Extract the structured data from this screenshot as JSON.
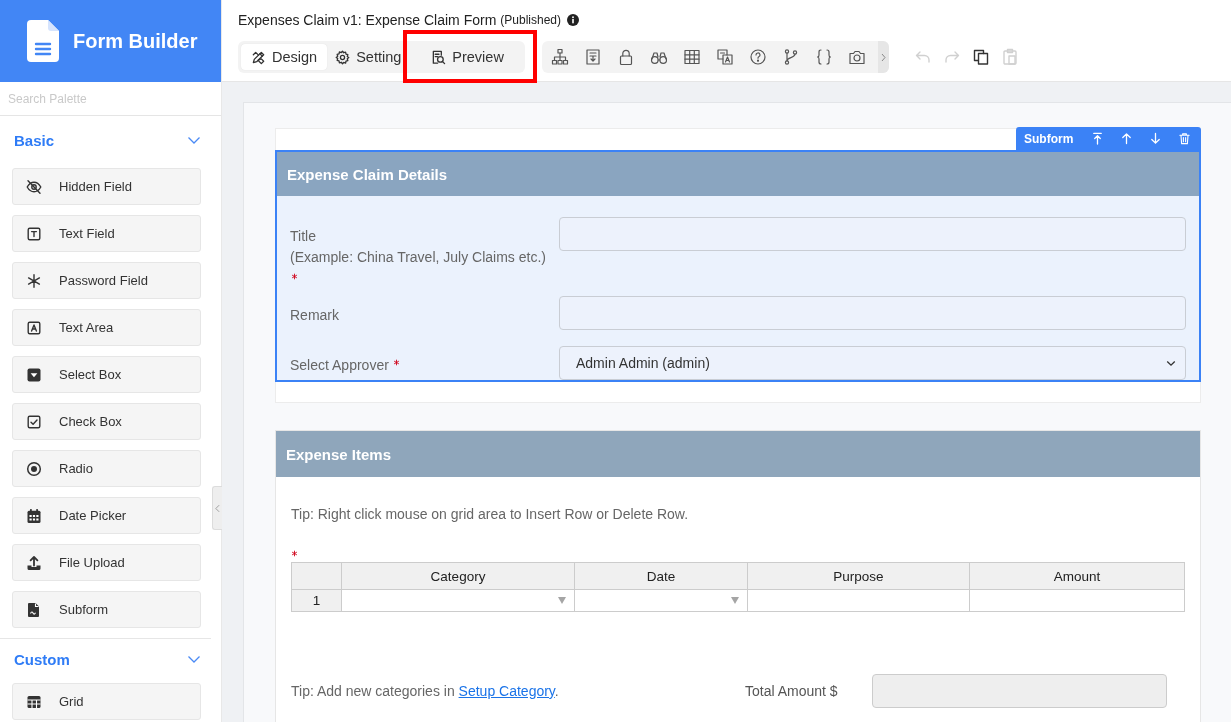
{
  "sidebar": {
    "brand": "Form Builder",
    "search": {
      "placeholder": "Search Palette"
    },
    "groups": [
      {
        "title": "Basic",
        "expanded": true,
        "items": [
          {
            "kind": "hidden",
            "label": "Hidden Field"
          },
          {
            "kind": "text",
            "label": "Text Field"
          },
          {
            "kind": "password",
            "label": "Password Field"
          },
          {
            "kind": "textarea",
            "label": "Text Area"
          },
          {
            "kind": "select",
            "label": "Select Box"
          },
          {
            "kind": "checkbox",
            "label": "Check Box"
          },
          {
            "kind": "radio",
            "label": "Radio"
          },
          {
            "kind": "date",
            "label": "Date Picker"
          },
          {
            "kind": "file",
            "label": "File Upload"
          },
          {
            "kind": "subform",
            "label": "Subform"
          }
        ]
      },
      {
        "title": "Custom",
        "expanded": true,
        "items": [
          {
            "kind": "grid",
            "label": "Grid"
          }
        ]
      }
    ]
  },
  "header": {
    "title": "Expenses Claim v1: Expense Claim Form",
    "status": "(Published)",
    "tabs": [
      {
        "kind": "design",
        "label": "Design",
        "selected": true,
        "highlighted": false
      },
      {
        "kind": "settings",
        "label": "Setting",
        "selected": false,
        "highlighted": false
      },
      {
        "kind": "preview",
        "label": "Preview",
        "selected": false,
        "highlighted": true
      }
    ],
    "edit_actions": [
      {
        "kind": "undo",
        "disabled": true
      },
      {
        "kind": "redo",
        "disabled": true
      },
      {
        "kind": "copy",
        "disabled": false
      },
      {
        "kind": "paste",
        "disabled": true
      }
    ]
  },
  "form": {
    "sections": [
      {
        "title": "Expense Claim Details",
        "selected": true,
        "toolbar_label": "Subform",
        "fields": [
          {
            "kind": "input",
            "label": "Title",
            "hint": "(Example: China Travel, July Claims etc.)",
            "required": true
          },
          {
            "kind": "input",
            "label": "Remark",
            "required": false
          },
          {
            "kind": "select",
            "label": "Select Approver",
            "required": true,
            "value": "Admin Admin (admin)"
          }
        ]
      },
      {
        "title": "Expense Items",
        "selected": false,
        "tip": "Tip: Right click mouse on grid area to Insert Row or Delete Row.",
        "grid": {
          "required": true,
          "columns": [
            {
              "kind": "dropdown",
              "label": "Category"
            },
            {
              "kind": "dropdown",
              "label": "Date"
            },
            {
              "kind": "text",
              "label": "Purpose"
            },
            {
              "kind": "text",
              "label": "Amount"
            }
          ],
          "rows": [
            {
              "number": "1"
            }
          ]
        },
        "footer": {
          "tip": "Tip: Add new categories in",
          "link": "Setup Category",
          "tip_end": ".",
          "total": {
            "label": "Total Amount $",
            "disabled": true
          }
        }
      }
    ]
  }
}
